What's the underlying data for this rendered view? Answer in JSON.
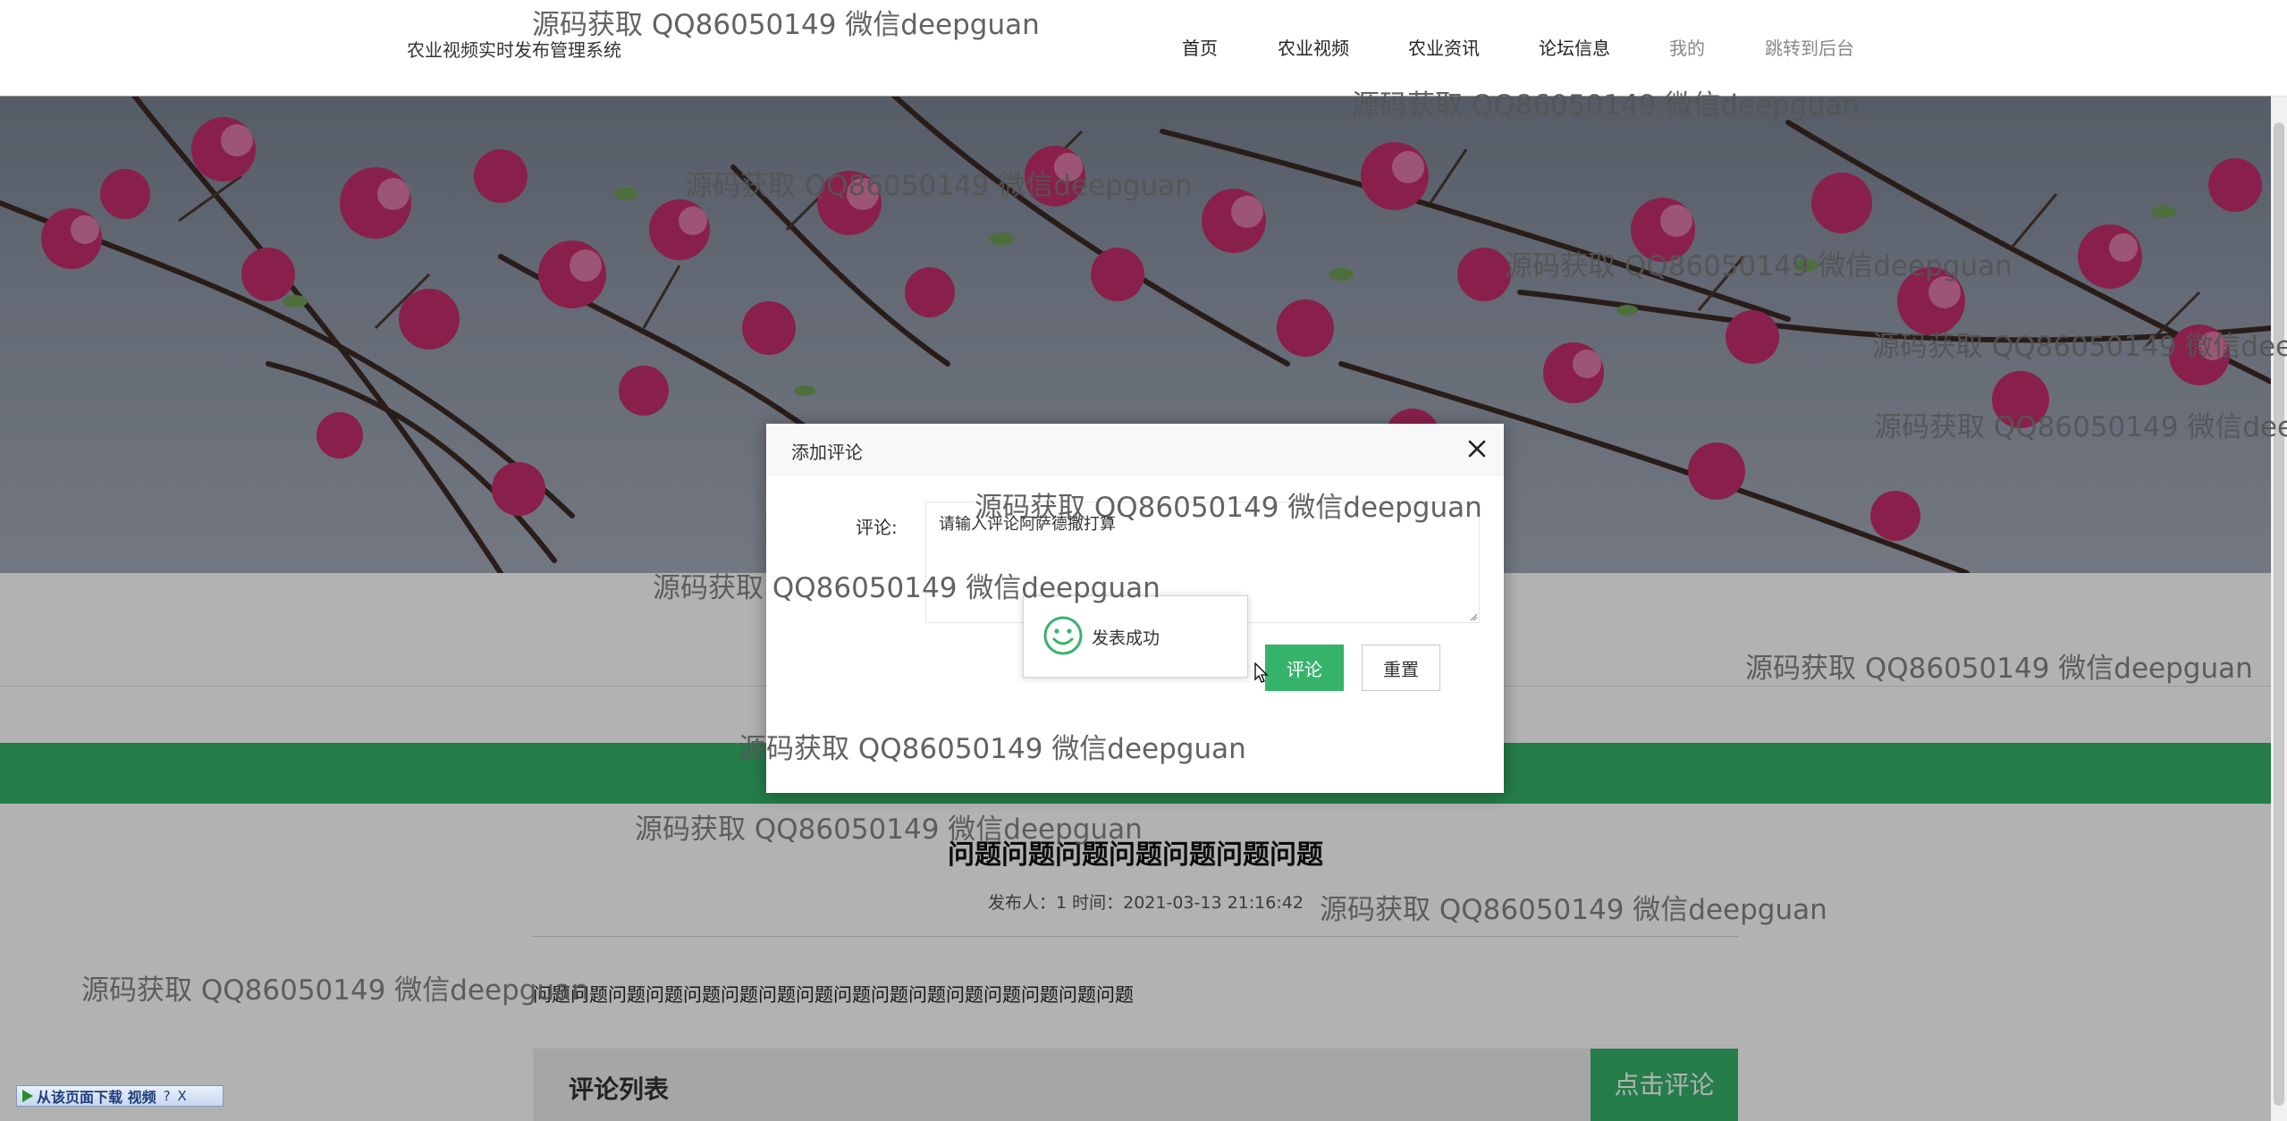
{
  "header": {
    "site_title": "农业视频实时发布管理系统",
    "nav": [
      {
        "label": "首页"
      },
      {
        "label": "农业视频"
      },
      {
        "label": "农业资讯"
      },
      {
        "label": "论坛信息"
      },
      {
        "label": "我的"
      },
      {
        "label": "跳转到后台"
      }
    ]
  },
  "article": {
    "title": "问题问题问题问题问题问题问题",
    "meta": "发布人：1 时间：2021-03-13 21:16:42",
    "body": "问题问题问题问题问题问题问题问题问题问题问题问题问题问题问题问题"
  },
  "comment_section": {
    "title": "评论列表",
    "add_button": "点击评论"
  },
  "modal": {
    "title": "添加评论",
    "field_label": "评论:",
    "textarea_value": "请输入评论阿萨德撒打算",
    "submit_label": "评论",
    "reset_label": "重置"
  },
  "toast": {
    "message": "发表成功"
  },
  "watermark": {
    "text": "源码获取 QQ86050149 微信deepguan"
  },
  "download_bar": {
    "label": "从该页面下载 视频",
    "help": "?",
    "close": "X"
  },
  "colors": {
    "accent": "#36b36b",
    "overlay": "rgba(0,0,0,0.30)"
  }
}
